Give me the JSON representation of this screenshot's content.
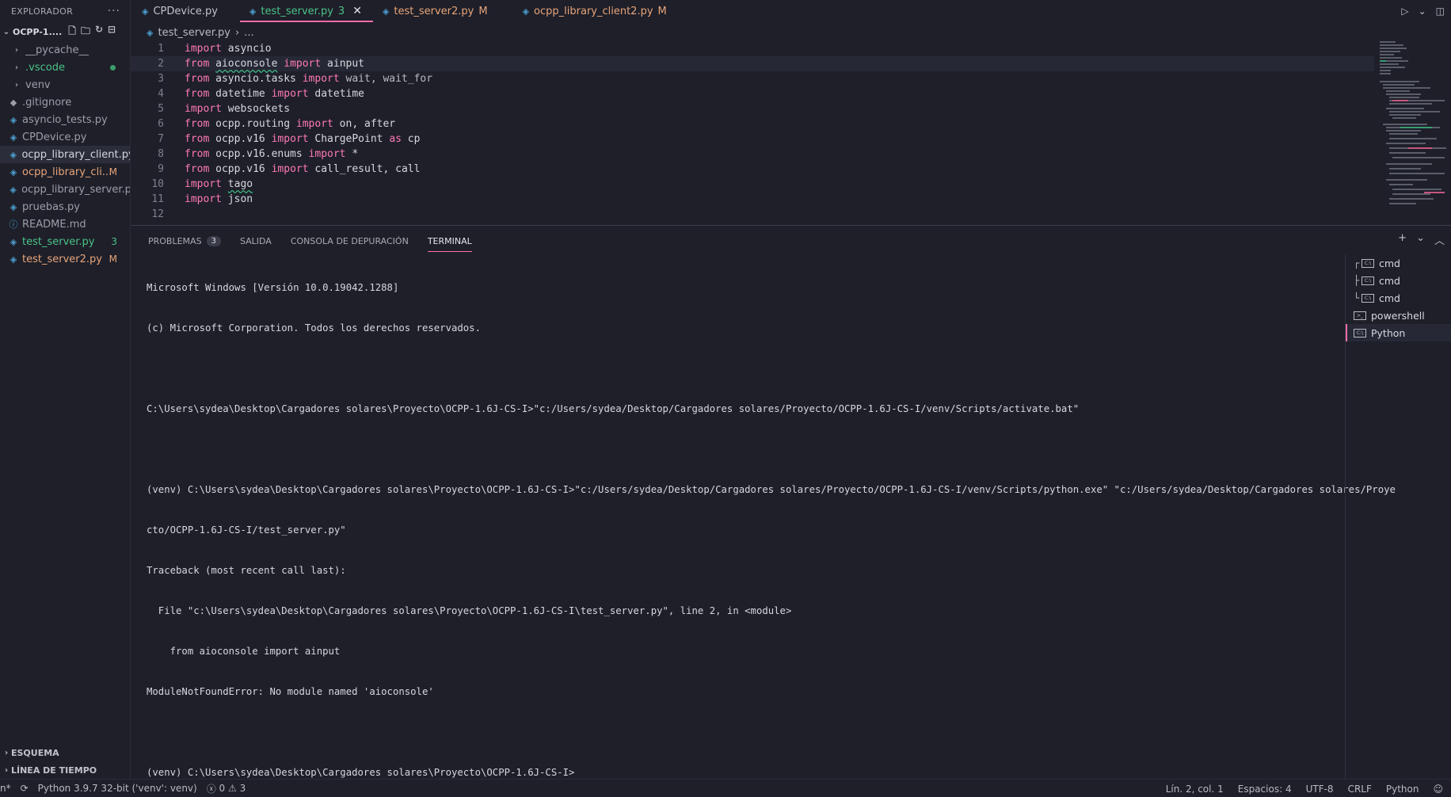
{
  "sidebar": {
    "title": "EXPLORADOR",
    "more": "···",
    "folder": "OCPP-1....",
    "items": [
      {
        "label": "__pycache__",
        "type": "folder"
      },
      {
        "label": ".vscode",
        "type": "folder"
      },
      {
        "label": "venv",
        "type": "folder"
      },
      {
        "label": ".gitignore",
        "type": "file"
      },
      {
        "label": "asyncio_tests.py",
        "type": "py"
      },
      {
        "label": "CPDevice.py",
        "type": "py"
      },
      {
        "label": "ocpp_library_client.py",
        "type": "py"
      },
      {
        "label": "ocpp_library_cli...",
        "type": "py",
        "badge": "M"
      },
      {
        "label": "ocpp_library_server.py",
        "type": "py"
      },
      {
        "label": "pruebas.py",
        "type": "py"
      },
      {
        "label": "README.md",
        "type": "md"
      },
      {
        "label": "test_server.py",
        "type": "py",
        "badge": "3"
      },
      {
        "label": "test_server2.py",
        "type": "py",
        "badge": "M"
      }
    ],
    "outline": "ESQUEMA",
    "timeline": "LÍNEA DE TIEMPO"
  },
  "tabs": [
    {
      "label": "CPDevice.py"
    },
    {
      "label": "test_server.py",
      "badge": "3",
      "close": "✕"
    },
    {
      "label": "test_server2.py",
      "badge": "M"
    },
    {
      "label": "ocpp_library_client2.py",
      "badge": "M"
    }
  ],
  "breadcrumb": {
    "file": "test_server.py",
    "rest": "..."
  },
  "editor": {
    "lines": [
      {
        "n": "1",
        "kw": "import",
        "rest": " asyncio"
      },
      {
        "n": "2",
        "kw": "from",
        "mod": "aioconsole",
        "kw2": "import",
        "rest": " ainput"
      },
      {
        "n": "3",
        "kw": "from",
        "mod": "asyncio.tasks",
        "kw2": "import",
        "rest": " wait, wait_for"
      },
      {
        "n": "4",
        "kw": "from",
        "mod": "datetime",
        "kw2": "import",
        "rest": " datetime"
      },
      {
        "n": "5",
        "kw": "import",
        "rest": " websockets"
      },
      {
        "n": "6",
        "kw": "from",
        "mod": "ocpp.routing",
        "kw2": "import",
        "rest": " on, after"
      },
      {
        "n": "7",
        "kw": "from",
        "mod": "ocpp.v16",
        "kw2": "import",
        "rest": " ChargePoint ",
        "kw3": "as",
        "rest2": " cp"
      },
      {
        "n": "8",
        "kw": "from",
        "mod": "ocpp.v16.enums",
        "kw2": "import",
        "rest": " *"
      },
      {
        "n": "9",
        "kw": "from",
        "mod": "ocpp.v16",
        "kw2": "import",
        "rest": " call_result, call"
      },
      {
        "n": "10",
        "kw": "import",
        "mod2": "tago"
      },
      {
        "n": "11",
        "kw": "import",
        "rest": " json"
      },
      {
        "n": "12"
      }
    ]
  },
  "panel": {
    "tabs": [
      {
        "label": "PROBLEMAS",
        "count": "3"
      },
      {
        "label": "SALIDA"
      },
      {
        "label": "CONSOLA DE DEPURACIÓN"
      },
      {
        "label": "TERMINAL"
      }
    ],
    "terminal_lines": [
      "Microsoft Windows [Versión 10.0.19042.1288]",
      "(c) Microsoft Corporation. Todos los derechos reservados.",
      "",
      "C:\\Users\\sydea\\Desktop\\Cargadores solares\\Proyecto\\OCPP-1.6J-CS-I>\"c:/Users/sydea/Desktop/Cargadores solares/Proyecto/OCPP-1.6J-CS-I/venv/Scripts/activate.bat\"",
      "",
      "(venv) C:\\Users\\sydea\\Desktop\\Cargadores solares\\Proyecto\\OCPP-1.6J-CS-I>\"c:/Users/sydea/Desktop/Cargadores solares/Proyecto/OCPP-1.6J-CS-I/venv/Scripts/python.exe\" \"c:/Users/sydea/Desktop/Cargadores solares/Proye",
      "cto/OCPP-1.6J-CS-I/test_server.py\"",
      "Traceback (most recent call last):",
      "  File \"c:\\Users\\sydea\\Desktop\\Cargadores solares\\Proyecto\\OCPP-1.6J-CS-I\\test_server.py\", line 2, in <module>",
      "    from aioconsole import ainput",
      "ModuleNotFoundError: No module named 'aioconsole'",
      "",
      "(venv) C:\\Users\\sydea\\Desktop\\Cargadores solares\\Proyecto\\OCPP-1.6J-CS-I>"
    ],
    "terminals": [
      {
        "label": "cmd",
        "glyph": "┌"
      },
      {
        "label": "cmd",
        "glyph": "├"
      },
      {
        "label": "cmd",
        "glyph": "└"
      },
      {
        "label": "powershell"
      },
      {
        "label": "Python"
      }
    ]
  },
  "status": {
    "left_cut": "n*",
    "interpreter": "Python 3.9.7 32-bit ('venv': venv)",
    "errors": "0",
    "warnings": "3",
    "position": "Lín. 2, col. 1",
    "spaces": "Espacios: 4",
    "encoding": "UTF-8",
    "eol": "CRLF",
    "language": "Python"
  },
  "colors": {
    "accent": "#ff6ca8",
    "modified": "#e8a57a",
    "git_added": "#4bc287",
    "python_icon": "#4ea1d3"
  }
}
